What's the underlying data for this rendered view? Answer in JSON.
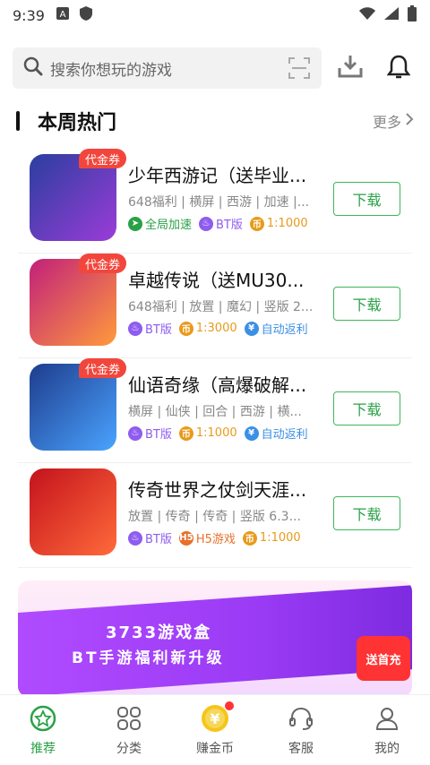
{
  "status_bar": {
    "time": "9:39"
  },
  "search": {
    "placeholder": "搜索你想玩的游戏"
  },
  "section": {
    "title": "本周热门",
    "more": "更多"
  },
  "games": [
    {
      "name": "少年西游记（送毕业...",
      "meta": "648福利 | 横屏 | 西游 | 加速 |...",
      "coupon": "代金券",
      "tags": [
        {
          "icon": "rocket-icon",
          "label": "全局加速",
          "color": "#2aa147"
        },
        {
          "icon": "flame-icon",
          "label": "BT版",
          "color": "#8e5cf0"
        },
        {
          "icon": "coin-icon",
          "label": "1:1000",
          "color": "#e89a1a"
        }
      ],
      "button": "下载",
      "colors": [
        "#2a3f9e",
        "#9b3cd8"
      ]
    },
    {
      "name": "卓越传说（送MU30...",
      "meta": "648福利 | 放置 | 魔幻 | 竖版 2...",
      "coupon": "代金券",
      "tags": [
        {
          "icon": "flame-icon",
          "label": "BT版",
          "color": "#8e5cf0"
        },
        {
          "icon": "coin-icon",
          "label": "1:3000",
          "color": "#e89a1a"
        },
        {
          "icon": "yen-icon",
          "label": "自动返利",
          "color": "#3b8fe6"
        }
      ],
      "button": "下载",
      "colors": [
        "#c1207a",
        "#ff9a3c"
      ]
    },
    {
      "name": "仙语奇缘（高爆破解...",
      "meta": "横屏 | 仙侠 | 回合 | 西游 | 横...",
      "coupon": "代金券",
      "tags": [
        {
          "icon": "flame-icon",
          "label": "BT版",
          "color": "#8e5cf0"
        },
        {
          "icon": "coin-icon",
          "label": "1:1000",
          "color": "#e89a1a"
        },
        {
          "icon": "yen-icon",
          "label": "自动返利",
          "color": "#3b8fe6"
        }
      ],
      "button": "下载",
      "colors": [
        "#1e3c8c",
        "#4aa3ff"
      ]
    },
    {
      "name": "传奇世界之仗剑天涯...",
      "meta": "放置 | 传奇 | 传奇 | 竖版 6.3...",
      "coupon": "",
      "tags": [
        {
          "icon": "flame-icon",
          "label": "BT版",
          "color": "#8e5cf0"
        },
        {
          "icon": "h5-icon",
          "label": "H5游戏",
          "color": "#e8702a"
        },
        {
          "icon": "coin-icon",
          "label": "1:1000",
          "color": "#e89a1a"
        }
      ],
      "button": "下载",
      "colors": [
        "#c4121d",
        "#ff6a3a"
      ]
    }
  ],
  "banner": {
    "title": "3733游戏盒",
    "subtitle": "BT手游福利新升级",
    "badge": "送首充"
  },
  "nav": [
    {
      "label": "推荐",
      "icon": "star-icon",
      "active": true
    },
    {
      "label": "分类",
      "icon": "category-icon",
      "active": false
    },
    {
      "label": "赚金币",
      "icon": "yen-coin-icon",
      "active": false
    },
    {
      "label": "客服",
      "icon": "headset-icon",
      "active": false
    },
    {
      "label": "我的",
      "icon": "user-icon",
      "active": false
    }
  ],
  "colors": {
    "accent": "#2aa147",
    "coupon": "#f2463c"
  }
}
